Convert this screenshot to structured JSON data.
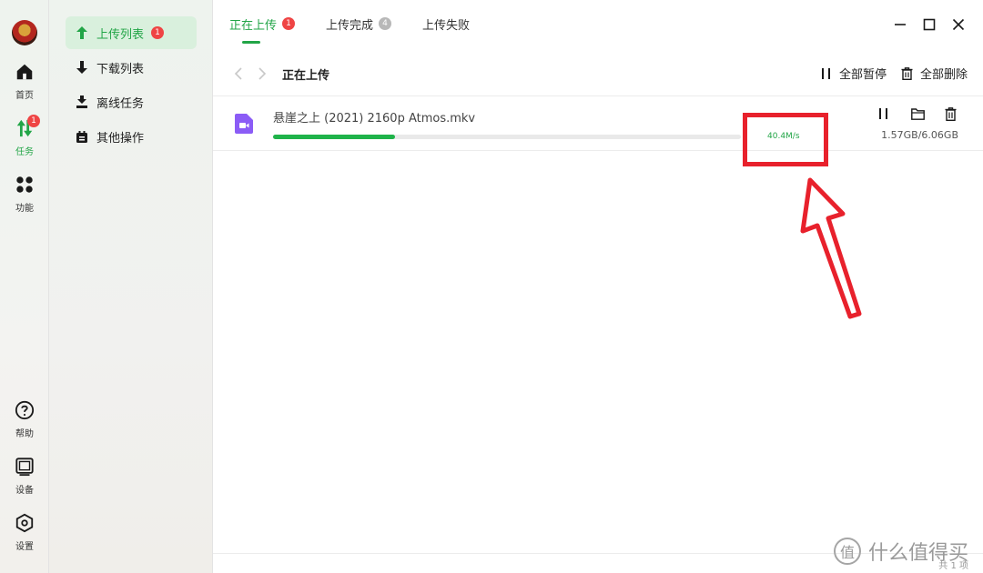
{
  "rail": {
    "items": [
      {
        "label": "首页",
        "icon": "home-icon"
      },
      {
        "label": "任务",
        "icon": "transfer-icon",
        "badge": "1"
      },
      {
        "label": "功能",
        "icon": "apps-icon"
      },
      {
        "label": "帮助",
        "icon": "help-icon"
      },
      {
        "label": "设备",
        "icon": "device-icon"
      },
      {
        "label": "设置",
        "icon": "settings-icon"
      }
    ]
  },
  "sidebar": {
    "items": [
      {
        "label": "上传列表",
        "badge": "1",
        "icon": "upload-arrow-icon"
      },
      {
        "label": "下载列表",
        "icon": "download-arrow-icon"
      },
      {
        "label": "离线任务",
        "icon": "offline-task-icon"
      },
      {
        "label": "其他操作",
        "icon": "other-ops-icon"
      }
    ]
  },
  "tabs": [
    {
      "label": "正在上传",
      "badge": "1"
    },
    {
      "label": "上传完成",
      "badge": "4"
    },
    {
      "label": "上传失败"
    }
  ],
  "toolbar": {
    "title": "正在上传",
    "pause_all": "全部暂停",
    "delete_all": "全部删除"
  },
  "task": {
    "file_name": "悬崖之上 (2021) 2160p Atmos.mkv",
    "speed": "40.4M/s",
    "size": "1.57GB/6.06GB",
    "progress": 0.26
  },
  "footer": {
    "count": "共 1 项"
  },
  "watermark": {
    "text": "什么值得买",
    "logo": "值"
  },
  "colors": {
    "accent": "#22a547",
    "badge": "#ef4444",
    "annotation": "#e8212c"
  }
}
